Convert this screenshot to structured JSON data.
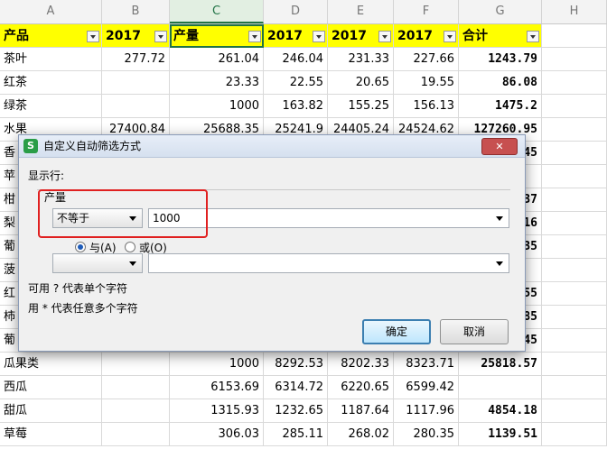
{
  "columns": [
    "A",
    "B",
    "C",
    "D",
    "E",
    "F",
    "G",
    "H"
  ],
  "selected_column": "C",
  "header_row": [
    "产品",
    "2017",
    "产量",
    "2017",
    "2017",
    "2017",
    "合计"
  ],
  "rows": [
    [
      "茶叶",
      "277.72",
      "261.04",
      "246.04",
      "231.33",
      "227.66",
      "1243.79"
    ],
    [
      "红茶",
      "",
      "23.33",
      "22.55",
      "20.65",
      "19.55",
      "86.08"
    ],
    [
      "绿茶",
      "",
      "1000",
      "163.82",
      "155.25",
      "156.13",
      "1475.2"
    ],
    [
      "水果",
      "27400.84",
      "25688.35",
      "25241.9",
      "24405.24",
      "24524.62",
      "127260.95"
    ],
    [
      "香",
      "",
      "",
      "",
      "",
      "",
      "45"
    ],
    [
      "苹",
      "",
      "",
      "",
      "",
      "",
      ""
    ],
    [
      "柑",
      "",
      "",
      "",
      "",
      "",
      "37"
    ],
    [
      "梨",
      "",
      "",
      "",
      "",
      "",
      "16"
    ],
    [
      "葡",
      "",
      "",
      "",
      "",
      "",
      "35"
    ],
    [
      "菠",
      "",
      "",
      "",
      "",
      "",
      ""
    ],
    [
      "红",
      "",
      "",
      "",
      "",
      "",
      "55"
    ],
    [
      "柿",
      "",
      "",
      "",
      "",
      "",
      "85"
    ],
    [
      "葡",
      "",
      "",
      "",
      "",
      "",
      "45"
    ],
    [
      "瓜果类",
      "",
      "1000",
      "8292.53",
      "8202.33",
      "8323.71",
      "25818.57"
    ],
    [
      "西瓜",
      "",
      "6153.69",
      "6314.72",
      "6220.65",
      "6599.42",
      ""
    ],
    [
      "甜瓜",
      "",
      "1315.93",
      "1232.65",
      "1187.64",
      "1117.96",
      "4854.18"
    ],
    [
      "草莓",
      "",
      "306.03",
      "285.11",
      "268.02",
      "280.35",
      "1139.51"
    ]
  ],
  "dialog": {
    "title": "自定义自动筛选方式",
    "close_label": "✕",
    "show_rows_label": "显示行:",
    "field_label": "产量",
    "condition1_operator": "不等于",
    "condition1_value": "1000",
    "radio_and": "与(A)",
    "radio_or": "或(O)",
    "condition2_operator": "",
    "condition2_value": "",
    "hint1": "可用 ? 代表单个字符",
    "hint2": "用 * 代表任意多个字符",
    "ok_label": "确定",
    "cancel_label": "取消"
  }
}
